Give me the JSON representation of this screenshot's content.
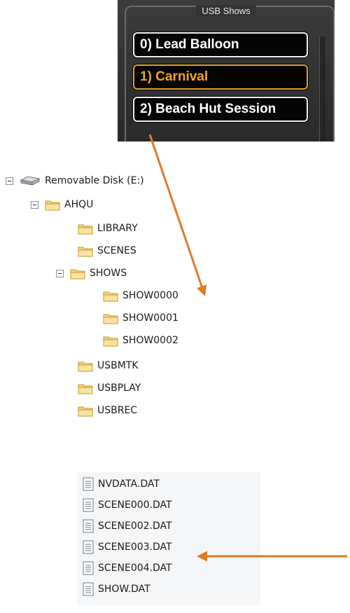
{
  "usb_shows": {
    "title": "USB Shows",
    "items": [
      {
        "label": "0) Lead Balloon",
        "active": false
      },
      {
        "label": "1) Carnival",
        "active": true
      },
      {
        "label": "2) Beach Hut Session",
        "active": false
      }
    ]
  },
  "tree": {
    "drive": "Removable Disk (E:)",
    "root": "AHQU",
    "folders": {
      "library": "LIBRARY",
      "scenes": "SCENES",
      "shows": "SHOWS",
      "show0": "SHOW0000",
      "show1": "SHOW0001",
      "show2": "SHOW0002",
      "usbmtk": "USBMTK",
      "usbplay": "USBPLAY",
      "usbrec": "USBREC"
    }
  },
  "files": [
    "NVDATA.DAT",
    "SCENE000.DAT",
    "SCENE002.DAT",
    "SCENE003.DAT",
    "SCENE004.DAT",
    "SHOW.DAT"
  ],
  "colors": {
    "arrow": "#e07a24",
    "active_border": "#e8a323",
    "active_text": "#f2a51c"
  }
}
